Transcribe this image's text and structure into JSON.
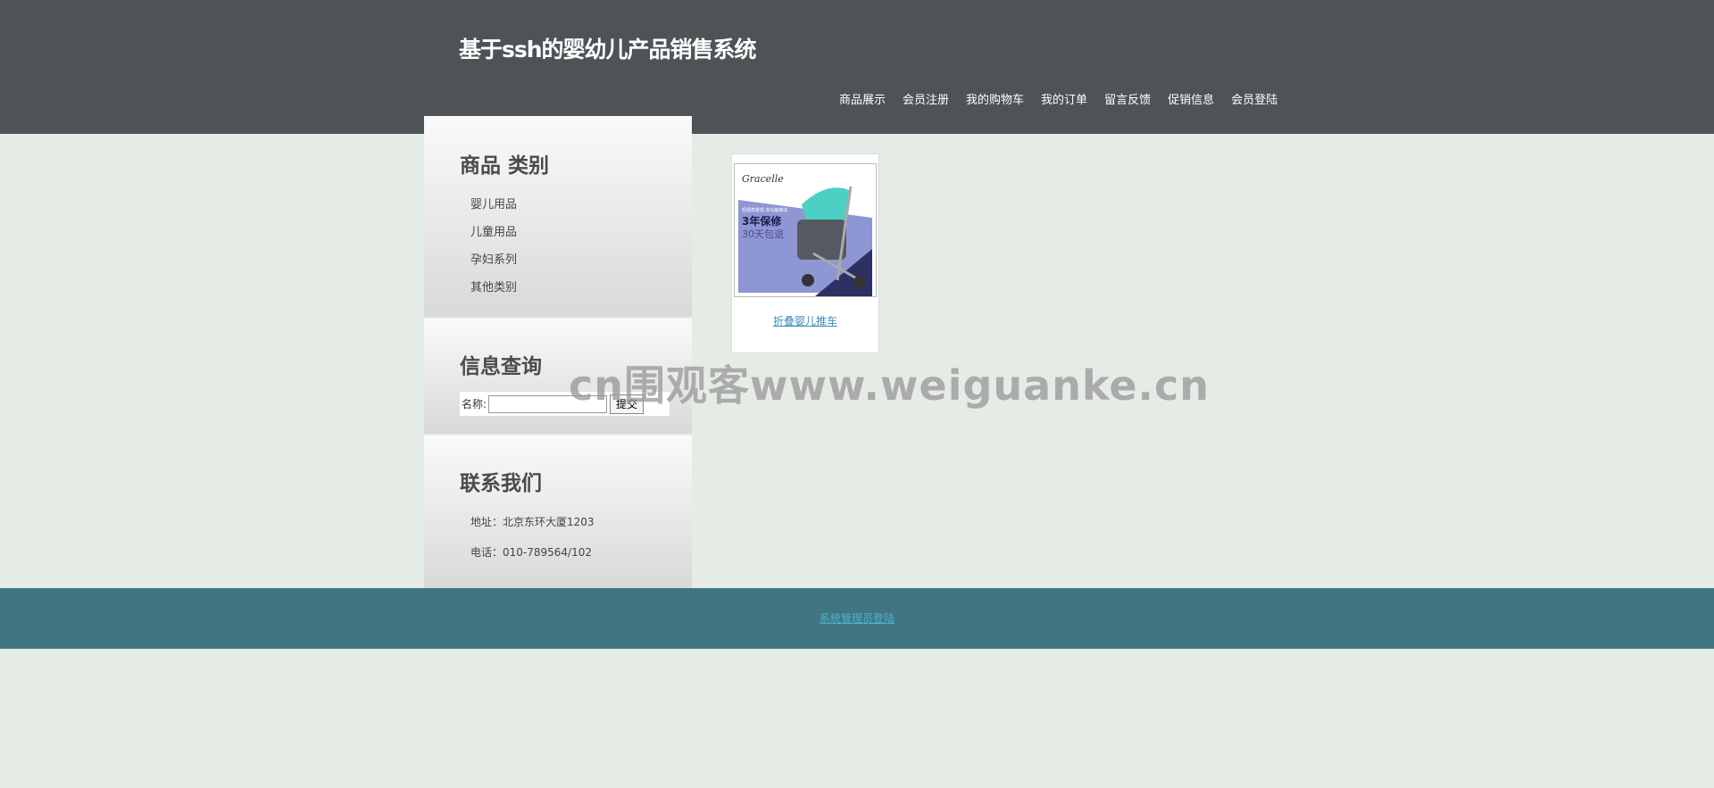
{
  "header": {
    "title": "基于ssh的婴幼儿产品销售系统",
    "nav": [
      "商品展示",
      "会员注册",
      "我的购物车",
      "我的订单",
      "留言反馈",
      "促销信息",
      "会员登陆"
    ]
  },
  "sidebar": {
    "category": {
      "title": "商品 类别",
      "items": [
        "婴儿用品",
        "儿童用品",
        "孕妇系列",
        "其他类别"
      ]
    },
    "search": {
      "title": "信息查询",
      "label": "名称:",
      "value": "",
      "button": "提交"
    },
    "contact": {
      "title": "联系我们",
      "address": "地址：北京东环大厦1203",
      "phone": "电话：010-789564/102"
    }
  },
  "product": {
    "name": "折叠婴儿推车",
    "image_text": {
      "brand": "Gracelle",
      "tagline": "轻便高景观 多功能推车",
      "warranty": "3年保修",
      "return": "30天包退"
    }
  },
  "watermark": "cn围观客www.weiguanke.cn",
  "footer": {
    "admin_link": "系统管理员登陆"
  },
  "colors": {
    "header_bg": "#4e5356",
    "page_bg": "#e5ece6",
    "footer_bg": "#417582",
    "link": "#3a8fb7"
  }
}
